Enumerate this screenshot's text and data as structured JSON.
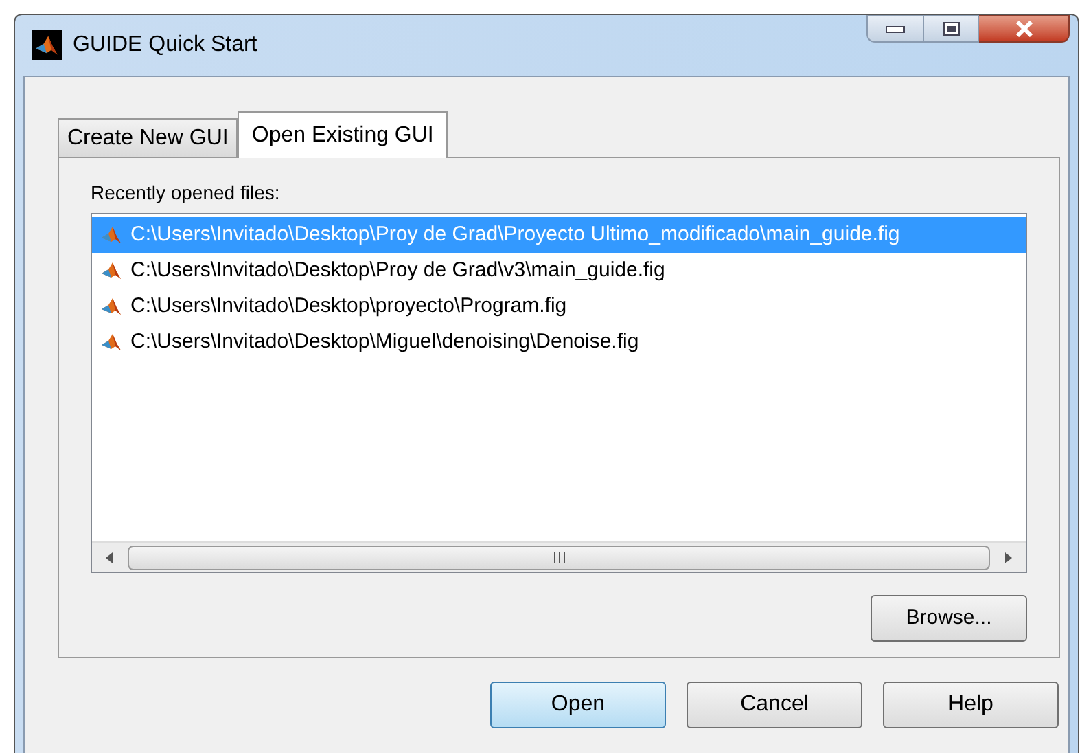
{
  "window": {
    "title": "GUIDE Quick Start"
  },
  "tabs": [
    {
      "label": "Create New GUI",
      "selected": false
    },
    {
      "label": "Open Existing GUI",
      "selected": true
    }
  ],
  "recent_label": "Recently opened files:",
  "files": [
    {
      "path": "C:\\Users\\Invitado\\Desktop\\Proy de Grad\\Proyecto Ultimo_modificado\\main_guide.fig",
      "selected": true
    },
    {
      "path": "C:\\Users\\Invitado\\Desktop\\Proy de Grad\\v3\\main_guide.fig",
      "selected": false
    },
    {
      "path": "C:\\Users\\Invitado\\Desktop\\proyecto\\Program.fig",
      "selected": false
    },
    {
      "path": "C:\\Users\\Invitado\\Desktop\\Miguel\\denoising\\Denoise.fig",
      "selected": false
    }
  ],
  "browse_button": "Browse...",
  "buttons": [
    {
      "label": "Open",
      "kind": "default"
    },
    {
      "label": "Cancel",
      "kind": "normal"
    },
    {
      "label": "Help",
      "kind": "normal"
    }
  ]
}
